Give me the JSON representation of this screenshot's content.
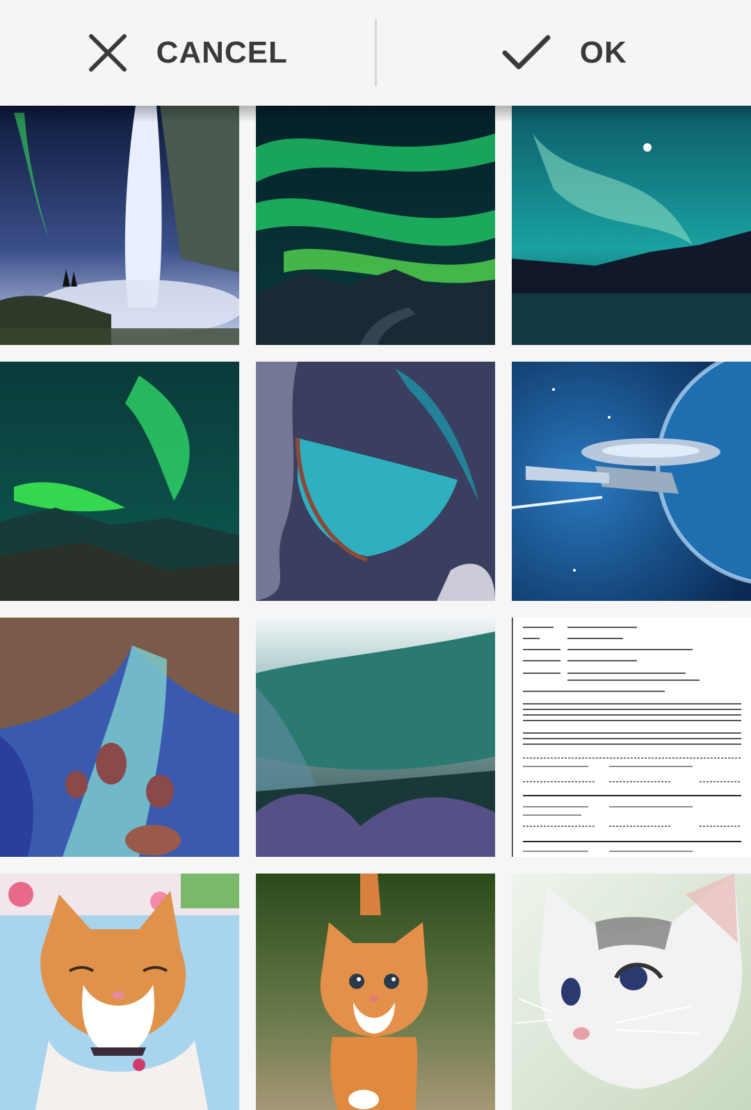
{
  "toolbar": {
    "cancel_label": "CANCEL",
    "ok_label": "OK",
    "cancel_icon": "close-icon",
    "ok_icon": "check-icon"
  },
  "images": [
    {
      "name": "aurora-waterfall"
    },
    {
      "name": "aurora-green-sky"
    },
    {
      "name": "aurora-lake"
    },
    {
      "name": "aurora-mountains"
    },
    {
      "name": "satellite-island"
    },
    {
      "name": "starship-space"
    },
    {
      "name": "river-delta-satellite"
    },
    {
      "name": "forest-valley"
    },
    {
      "name": "text-document"
    },
    {
      "name": "smiling-cat"
    },
    {
      "name": "orange-kitten"
    },
    {
      "name": "white-kitten"
    }
  ]
}
